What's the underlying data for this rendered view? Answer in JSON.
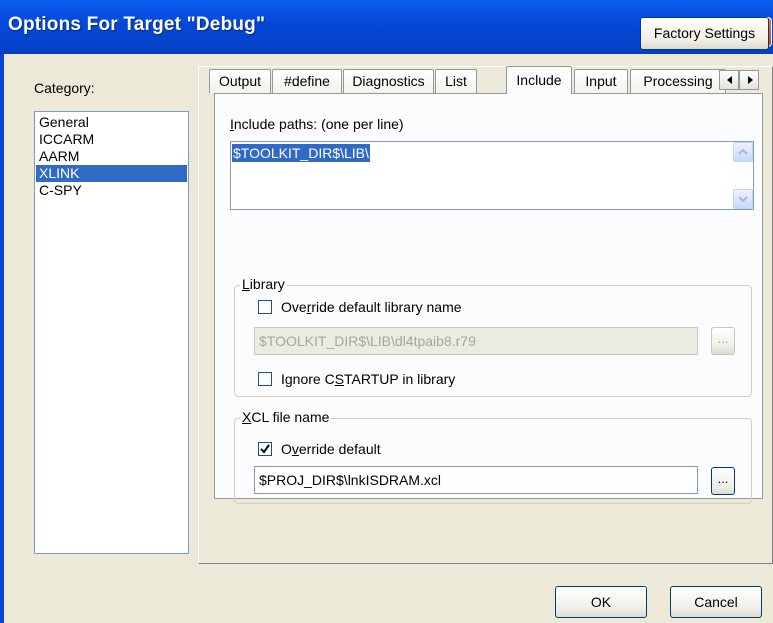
{
  "window": {
    "title": "Options For Target \"Debug\"",
    "colors": {
      "titlebar": "#0548d8",
      "selection": "#316ac5",
      "dialog_bg": "#ece9d8",
      "close": "#cf3f1c"
    }
  },
  "sidebar": {
    "label": "Category:",
    "items": [
      {
        "label": "General",
        "selected": false
      },
      {
        "label": "ICCARM",
        "selected": false
      },
      {
        "label": "AARM",
        "selected": false
      },
      {
        "label": "XLINK",
        "selected": true
      },
      {
        "label": "C-SPY",
        "selected": false
      }
    ]
  },
  "factory_settings_label": "Factory Settings",
  "tabs": [
    {
      "label": "Output",
      "active": false
    },
    {
      "label": "#define",
      "active": false
    },
    {
      "label": "Diagnostics",
      "active": false
    },
    {
      "label": "List",
      "active": false
    },
    {
      "label": "Include",
      "active": true
    },
    {
      "label": "Input",
      "active": false
    },
    {
      "label": "Processing",
      "active": false
    }
  ],
  "include": {
    "label_prefix": "I",
    "label_rest": "nclude paths:  (one per line)",
    "value": "$TOOLKIT_DIR$\\LIB\\"
  },
  "library": {
    "group_prefix": "L",
    "group_rest": "ibrary",
    "override_pre": "Ove",
    "override_key": "r",
    "override_post": "ride default library name",
    "override_checked": false,
    "path_value": "$TOOLKIT_DIR$\\LIB\\dl4tpaib8.r79",
    "browse_label": "...",
    "ignore_pre": "Ignore C",
    "ignore_key": "S",
    "ignore_post": "TARTUP in library",
    "ignore_checked": false
  },
  "xcl": {
    "group_prefix": "X",
    "group_rest": "CL file name",
    "override_pre": "O",
    "override_key": "v",
    "override_post": "erride default",
    "override_checked": true,
    "path_value": "$PROJ_DIR$\\lnkISDRAM.xcl",
    "browse_label": "..."
  },
  "footer": {
    "ok_label": "OK",
    "cancel_label": "Cancel"
  }
}
